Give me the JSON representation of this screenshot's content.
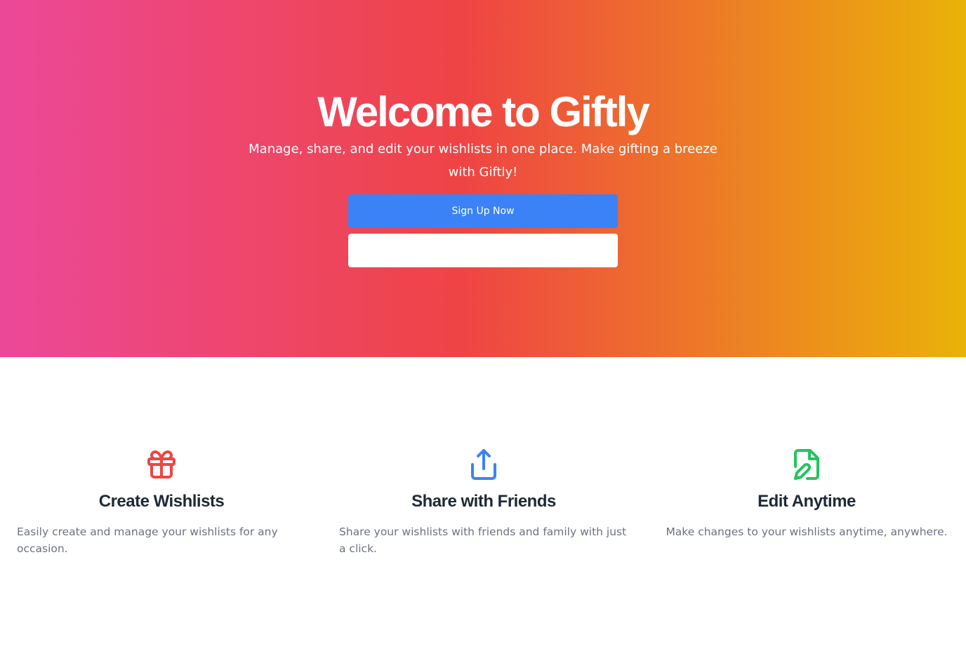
{
  "hero": {
    "title": "Welcome to Giftly",
    "subtitle": "Manage, share, and edit your wishlists in one place. Make gifting a breeze with Giftly!",
    "primary_button_label": "Sign Up Now",
    "secondary_button_label": ""
  },
  "features": [
    {
      "icon": "gift-icon",
      "icon_color": "#ef4444",
      "title": "Create Wishlists",
      "description": "Easily create and manage your wishlists for any occasion."
    },
    {
      "icon": "share-icon",
      "icon_color": "#3b82f6",
      "title": "Share with Friends",
      "description": "Share your wishlists with friends and family with just a click."
    },
    {
      "icon": "edit-document-icon",
      "icon_color": "#22c55e",
      "title": "Edit Anytime",
      "description": "Make changes to your wishlists anytime, anywhere."
    }
  ],
  "colors": {
    "gradient_start": "#ec4899",
    "gradient_mid": "#ef4444",
    "gradient_end": "#eab308",
    "primary_button": "#3b82f6"
  }
}
